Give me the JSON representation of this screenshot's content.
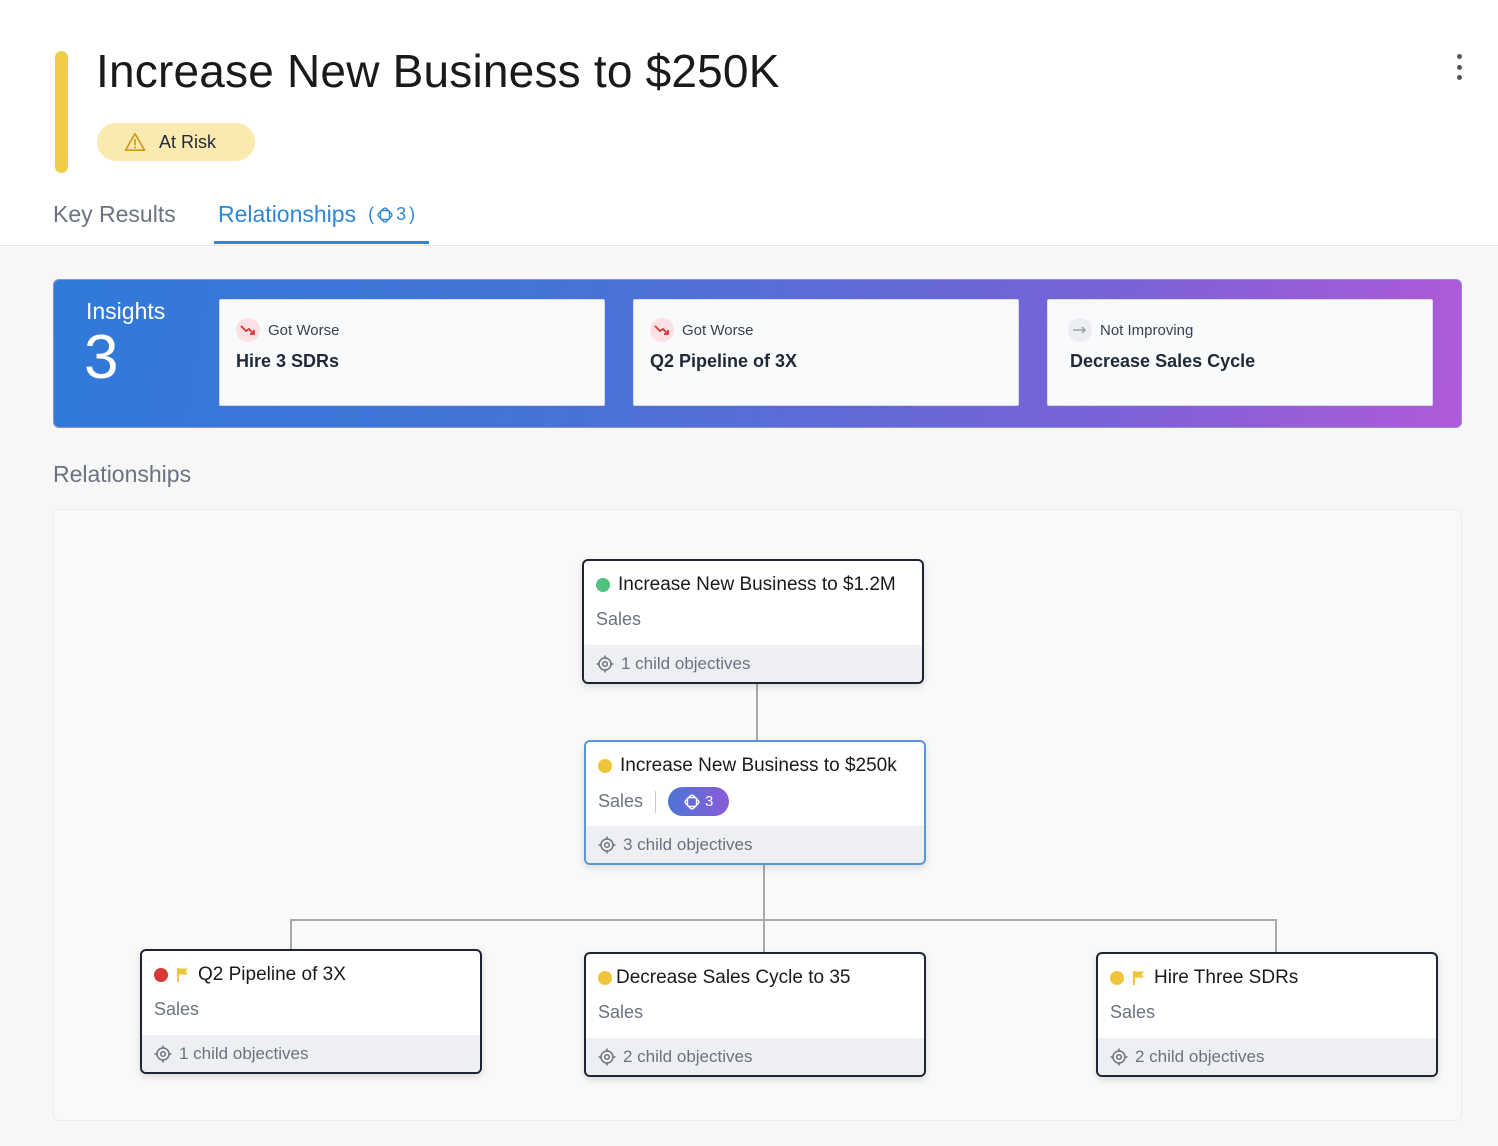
{
  "objective": {
    "title": "Increase New Business to $250K",
    "status_label": "At Risk",
    "accent_color": "#f0cc47",
    "status_color": "#fbeab0"
  },
  "tabs": {
    "key_results": "Key Results",
    "relationships": "Relationships",
    "relationships_count_open": "(",
    "relationships_count": "3",
    "relationships_count_close": ")"
  },
  "insights": {
    "label": "Insights",
    "count": "3",
    "cards": [
      {
        "trend": "Got Worse",
        "name": "Hire 3 SDRs",
        "icon": "trend-down-icon"
      },
      {
        "trend": "Got Worse",
        "name": "Q2 Pipeline of 3X",
        "icon": "trend-down-icon"
      },
      {
        "trend": "Not Improving",
        "name": "Decrease Sales Cycle",
        "icon": "trend-flat-icon"
      }
    ]
  },
  "relationships_section": {
    "title": "Relationships"
  },
  "tree": {
    "parent": {
      "title": "Increase New Business to $1.2M",
      "team": "Sales",
      "children": "1 child objectives",
      "status_color": "#4ec27e"
    },
    "current": {
      "title": "Increase New Business to $250k",
      "team": "Sales",
      "badge": "3",
      "children": "3 child objectives",
      "status_color": "#f0c43a"
    },
    "children": [
      {
        "title": "Q2 Pipeline of 3X",
        "team": "Sales",
        "children": "1 child objectives",
        "status_color": "#d93636",
        "flagged": true
      },
      {
        "title": "Decrease Sales Cycle to 35",
        "team": "Sales",
        "children": "2 child objectives",
        "status_color": "#f0c43a",
        "flagged": false
      },
      {
        "title": "Hire Three SDRs",
        "team": "Sales",
        "children": "2 child objectives",
        "status_color": "#f0c43a",
        "flagged": true
      }
    ]
  }
}
